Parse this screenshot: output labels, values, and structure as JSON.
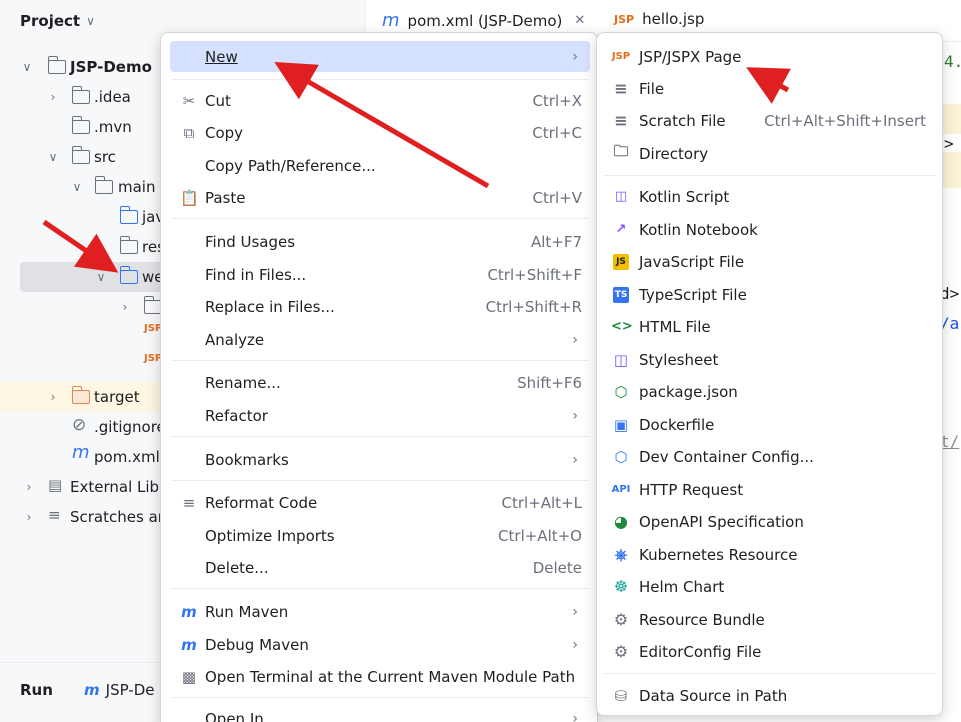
{
  "project_panel": {
    "title": "Project",
    "tree": [
      {
        "label": "JSP-Demo",
        "bold": true
      },
      {
        "label": ".idea"
      },
      {
        "label": ".mvn"
      },
      {
        "label": "src"
      },
      {
        "label": "main"
      },
      {
        "label": "jav"
      },
      {
        "label": "res"
      },
      {
        "label": "we"
      },
      {
        "label": ""
      },
      {
        "label": ""
      },
      {
        "label": ""
      },
      {
        "label": "target"
      },
      {
        "label": ".gitignore"
      },
      {
        "label": "pom.xml"
      },
      {
        "label": "External Libr"
      },
      {
        "label": "Scratches an"
      }
    ],
    "jsp_badge": "JSP"
  },
  "run_bar": {
    "title": "Run",
    "tab_label": "JSP-De"
  },
  "editor": {
    "tabs": [
      {
        "label": "pom.xml (JSP-Demo)",
        "icon": "maven-m-icon"
      },
      {
        "label": "hello.jsp",
        "icon": "jsp-icon"
      }
    ],
    "fragments": [
      "4.",
      ">",
      "d>",
      "/a",
      "t/"
    ]
  },
  "context_menu": {
    "items": [
      {
        "label": "New",
        "shortcut": "",
        "submenu": true,
        "icon": ""
      },
      {
        "label": "Cut",
        "shortcut": "Ctrl+X",
        "icon": "scissors-icon"
      },
      {
        "label": "Copy",
        "shortcut": "Ctrl+C",
        "icon": "copy-icon"
      },
      {
        "label": "Copy Path/Reference...",
        "shortcut": "",
        "icon": ""
      },
      {
        "label": "Paste",
        "shortcut": "Ctrl+V",
        "icon": "paste-icon"
      },
      {
        "label": "Find Usages",
        "shortcut": "Alt+F7",
        "icon": ""
      },
      {
        "label": "Find in Files...",
        "shortcut": "Ctrl+Shift+F",
        "icon": ""
      },
      {
        "label": "Replace in Files...",
        "shortcut": "Ctrl+Shift+R",
        "icon": ""
      },
      {
        "label": "Analyze",
        "shortcut": "",
        "submenu": true,
        "icon": ""
      },
      {
        "label": "Rename...",
        "shortcut": "Shift+F6",
        "icon": ""
      },
      {
        "label": "Refactor",
        "shortcut": "",
        "submenu": true,
        "icon": ""
      },
      {
        "label": "Bookmarks",
        "shortcut": "",
        "submenu": true,
        "icon": ""
      },
      {
        "label": "Reformat Code",
        "shortcut": "Ctrl+Alt+L",
        "icon": "reformat-icon"
      },
      {
        "label": "Optimize Imports",
        "shortcut": "Ctrl+Alt+O",
        "icon": ""
      },
      {
        "label": "Delete...",
        "shortcut": "Delete",
        "icon": ""
      },
      {
        "label": "Run Maven",
        "shortcut": "",
        "submenu": true,
        "icon": "run-maven-icon"
      },
      {
        "label": "Debug Maven",
        "shortcut": "",
        "submenu": true,
        "icon": "debug-maven-icon"
      },
      {
        "label": "Open Terminal at the Current Maven Module Path",
        "shortcut": "",
        "icon": "terminal-icon"
      },
      {
        "label": "Open In",
        "shortcut": "",
        "submenu": true,
        "icon": ""
      }
    ]
  },
  "new_submenu": {
    "items": [
      {
        "label": "JSP/JSPX Page",
        "shortcut": "",
        "icon": "jsp-icon"
      },
      {
        "label": "File",
        "shortcut": "",
        "icon": "file-icon"
      },
      {
        "label": "Scratch File",
        "shortcut": "Ctrl+Alt+Shift+Insert",
        "icon": "scratch-file-icon"
      },
      {
        "label": "Directory",
        "shortcut": "",
        "icon": "folder-icon"
      },
      {
        "label": "Kotlin Script",
        "shortcut": "",
        "icon": "kotlin-script-icon"
      },
      {
        "label": "Kotlin Notebook",
        "shortcut": "",
        "icon": "kotlin-notebook-icon"
      },
      {
        "label": "JavaScript File",
        "shortcut": "",
        "icon": "javascript-icon"
      },
      {
        "label": "TypeScript File",
        "shortcut": "",
        "icon": "typescript-icon"
      },
      {
        "label": "HTML File",
        "shortcut": "",
        "icon": "html-icon"
      },
      {
        "label": "Stylesheet",
        "shortcut": "",
        "icon": "css-icon"
      },
      {
        "label": "package.json",
        "shortcut": "",
        "icon": "nodejs-icon"
      },
      {
        "label": "Dockerfile",
        "shortcut": "",
        "icon": "docker-icon"
      },
      {
        "label": "Dev Container Config...",
        "shortcut": "",
        "icon": "dev-container-icon"
      },
      {
        "label": "HTTP Request",
        "shortcut": "",
        "icon": "api-icon"
      },
      {
        "label": "OpenAPI Specification",
        "shortcut": "",
        "icon": "openapi-icon"
      },
      {
        "label": "Kubernetes Resource",
        "shortcut": "",
        "icon": "kubernetes-icon"
      },
      {
        "label": "Helm Chart",
        "shortcut": "",
        "icon": "helm-icon"
      },
      {
        "label": "Resource Bundle",
        "shortcut": "",
        "icon": "gear-icon"
      },
      {
        "label": "EditorConfig File",
        "shortcut": "",
        "icon": "gear-icon"
      },
      {
        "label": "Data Source in Path",
        "shortcut": "",
        "icon": "database-icon"
      }
    ]
  },
  "colors": {
    "accent": "#3574f0",
    "menu_highlight": "#d5e1ff",
    "annotation_arrow": "#e02020",
    "jsp_orange": "#e66d17"
  }
}
